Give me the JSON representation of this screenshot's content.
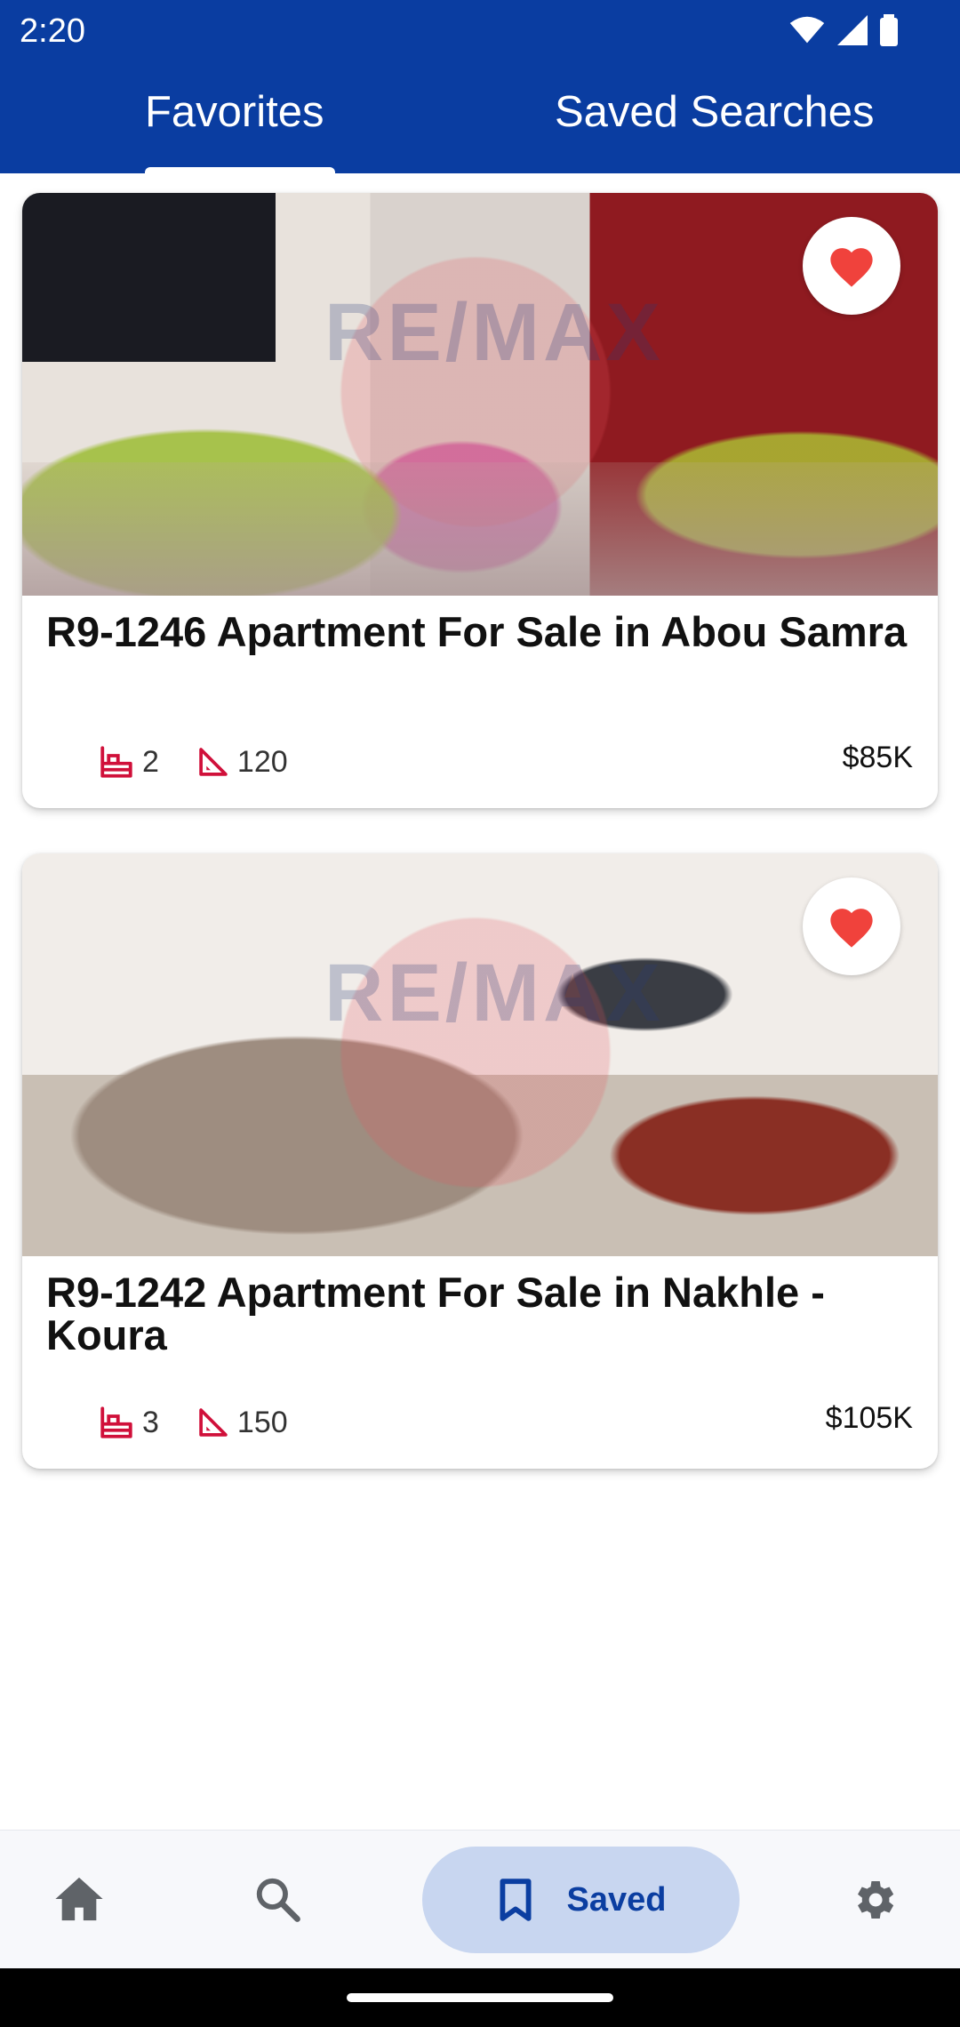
{
  "status_bar": {
    "time": "2:20",
    "icons": [
      "wifi-icon",
      "cellular-signal-icon",
      "battery-icon"
    ]
  },
  "tabs": [
    {
      "label": "Favorites",
      "selected": true
    },
    {
      "label": "Saved Searches",
      "selected": false
    }
  ],
  "listings": [
    {
      "title": "R9-1246 Apartment For Sale in Abou Samra",
      "bedrooms": "2",
      "area": "120",
      "price": "$85K",
      "favorited": true
    },
    {
      "title": "R9-1242 Apartment For Sale in Nakhle - Koura",
      "bedrooms": "3",
      "area": "150",
      "price": "$105K",
      "favorited": true
    }
  ],
  "bottom_nav": {
    "items": [
      "home-icon",
      "search-icon",
      "bookmark-icon",
      "gear-icon"
    ],
    "saved_label": "Saved"
  },
  "colors": {
    "primary": "#0a3da1",
    "favorite": "#f0423c",
    "accent_icons": "#d0103a",
    "nav_active_bg": "#c8d6f0"
  }
}
